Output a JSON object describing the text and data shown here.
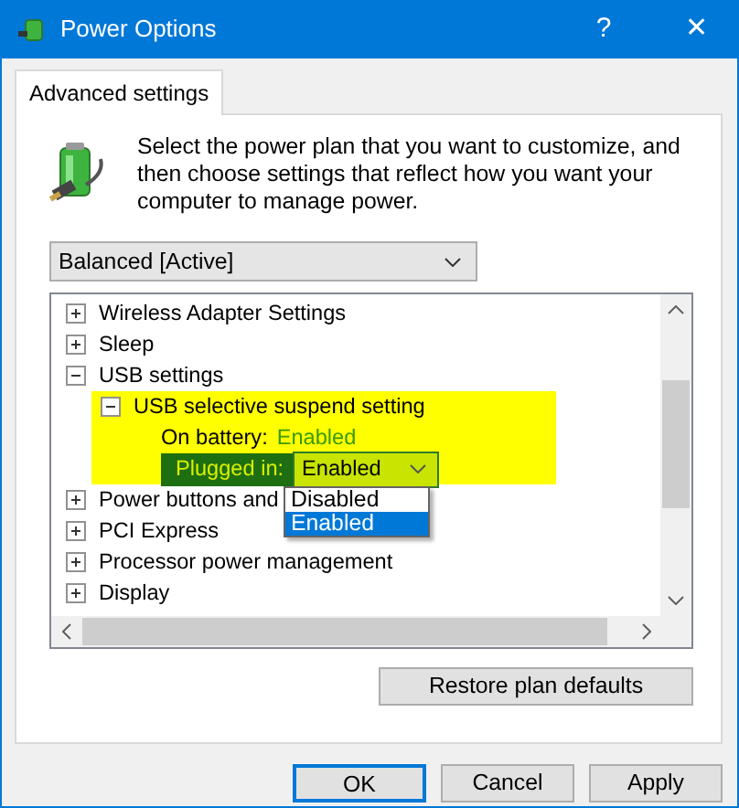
{
  "window": {
    "title": "Power Options",
    "buttons": [
      "?",
      "✕"
    ]
  },
  "tabs": [
    {
      "label": "Advanced settings",
      "selected": true
    }
  ],
  "description": "Select the power plan that you want to customize, and then choose settings that reflect how you want your computer to manage power.",
  "plan_select": {
    "value": "Balanced [Active]"
  },
  "tree": [
    {
      "label": "Wireless Adapter Settings",
      "expanded": false
    },
    {
      "label": "Sleep",
      "expanded": false
    },
    {
      "label": "USB settings",
      "expanded": true,
      "children": [
        {
          "label": "USB selective suspend setting",
          "expanded": true,
          "highlighted": true,
          "children": [
            {
              "kind": "value",
              "label": "On battery:",
              "value": "Enabled",
              "selected": false
            },
            {
              "kind": "dropdown",
              "label": "Plugged in:",
              "value": "Enabled",
              "selected": true,
              "options": [
                {
                  "label": "Disabled",
                  "selected": false
                },
                {
                  "label": "Enabled",
                  "selected": true
                }
              ]
            }
          ]
        }
      ]
    },
    {
      "label": "Power buttons and",
      "expanded": false
    },
    {
      "label": "PCI Express",
      "expanded": false
    },
    {
      "label": "Processor power management",
      "expanded": false
    },
    {
      "label": "Display",
      "expanded": false
    }
  ],
  "restore_button": "Restore plan defaults",
  "buttons": [
    {
      "label": "OK",
      "default": true
    },
    {
      "label": "Cancel",
      "default": false
    },
    {
      "label": "Apply",
      "default": false
    }
  ]
}
